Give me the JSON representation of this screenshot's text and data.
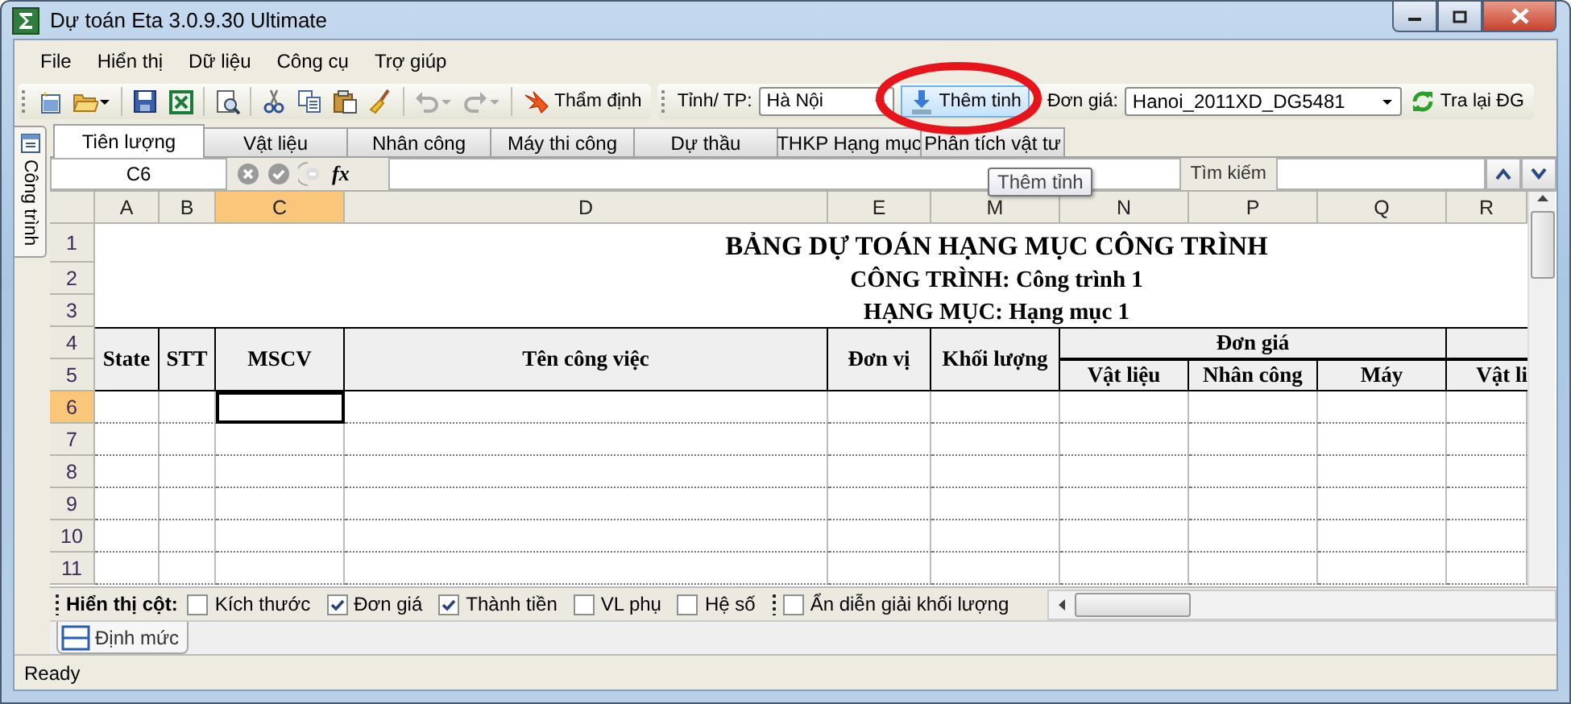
{
  "window": {
    "title": "Dự toán Eta 3.0.9.30 Ultimate"
  },
  "menu": [
    "File",
    "Hiển thị",
    "Dữ liệu",
    "Công cụ",
    "Trợ giúp"
  ],
  "toolbar": {
    "review_button": "Thẩm định",
    "province_label": "Tỉnh/ TP:",
    "province": "Hà Nội",
    "add_province_button": {
      "label": "Thêm tinh",
      "hovered": true
    },
    "price_label": "Đơn giá:",
    "price_set": "Hanoi_2011XD_DG5481",
    "reload_button": "Tra lại ĐG"
  },
  "side_panel": {
    "label": "Công trình"
  },
  "tabs": [
    {
      "label": "Tiên lượng",
      "selected": true
    },
    {
      "label": "Vật liệu",
      "selected": false
    },
    {
      "label": "Nhân công",
      "selected": false
    },
    {
      "label": "Máy thi công",
      "selected": false
    },
    {
      "label": "Dự thầu",
      "selected": false
    },
    {
      "label": "THKP Hạng mục",
      "selected": false
    },
    {
      "label": "Phân tích vật tư",
      "selected": false
    }
  ],
  "formula_bar": {
    "cell": "C6",
    "fx": "fx",
    "search_label": "Tìm kiếm"
  },
  "tooltip": {
    "text": "Thêm tỉnh"
  },
  "sheet": {
    "columns": [
      {
        "label": "A",
        "selected": false
      },
      {
        "label": "B",
        "selected": false
      },
      {
        "label": "C",
        "selected": true
      },
      {
        "label": "D",
        "selected": false
      },
      {
        "label": "E",
        "selected": false
      },
      {
        "label": "M",
        "selected": false
      },
      {
        "label": "N",
        "selected": false
      },
      {
        "label": "P",
        "selected": false
      },
      {
        "label": "Q",
        "selected": false
      },
      {
        "label": "R",
        "selected": false
      }
    ],
    "rows": [
      {
        "label": "1",
        "selected": false
      },
      {
        "label": "2",
        "selected": false
      },
      {
        "label": "3",
        "selected": false
      },
      {
        "label": "4",
        "selected": false
      },
      {
        "label": "5",
        "selected": false
      },
      {
        "label": "6",
        "selected": true
      },
      {
        "label": "7",
        "selected": false
      },
      {
        "label": "8",
        "selected": false
      },
      {
        "label": "9",
        "selected": false
      },
      {
        "label": "10",
        "selected": false
      },
      {
        "label": "11",
        "selected": false
      }
    ],
    "title_lines": [
      "BẢNG DỰ TOÁN HẠNG MỤC CÔNG TRÌNH",
      "CÔNG TRÌNH: Công trình 1",
      "HẠNG MỤC: Hạng mục 1"
    ],
    "headers": [
      "State",
      "STT",
      "MSCV",
      "Tên công việc",
      "Đơn vị",
      "Khối lượng"
    ],
    "group_header": "Đơn giá",
    "sub_headers": [
      "Vật liệu",
      "Nhân công",
      "Máy"
    ],
    "last_sub_header": "Vật li"
  },
  "column_options": {
    "label": "Hiển thị cột:",
    "options": [
      {
        "label": "Kích thước",
        "checked": false
      },
      {
        "label": "Đơn giá",
        "checked": true
      },
      {
        "label": "Thành tiền",
        "checked": true
      },
      {
        "label": "VL phụ",
        "checked": false
      },
      {
        "label": "Hệ số",
        "checked": false
      }
    ],
    "extra": [
      {
        "label": "Ẩn diễn giải khối lượng",
        "checked": false
      }
    ]
  },
  "sheet_tabs": [
    {
      "label": "Định mức",
      "selected": true
    }
  ],
  "status_bar": {
    "text": "Ready"
  },
  "annotations": [
    {
      "kind": "ellipse"
    }
  ]
}
